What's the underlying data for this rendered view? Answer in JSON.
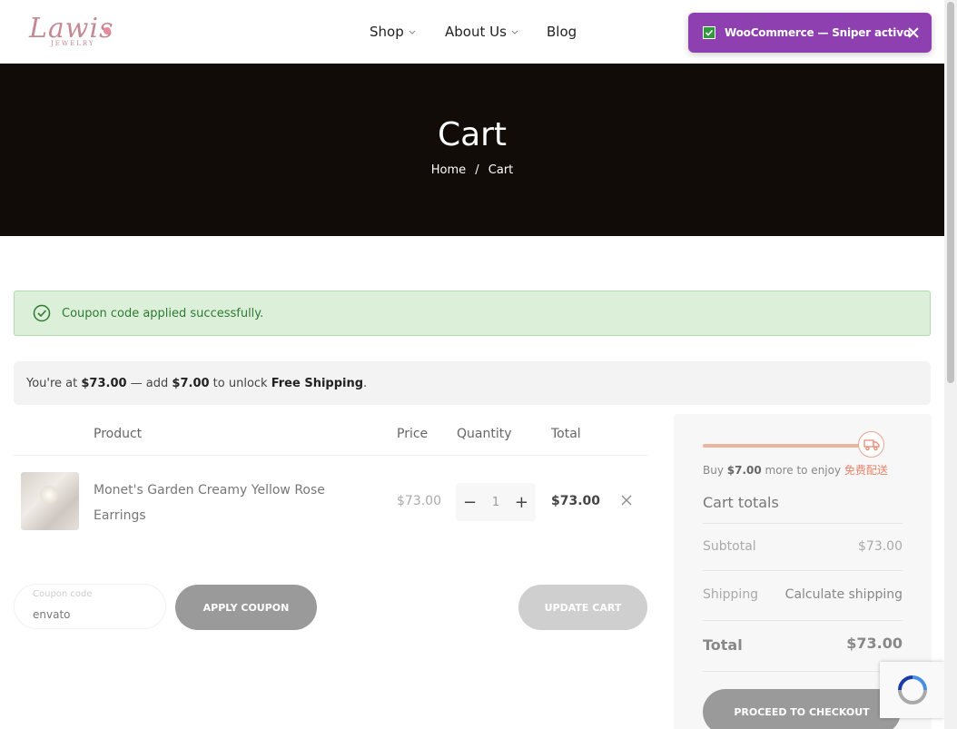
{
  "header": {
    "logo_text": "Lawis",
    "logo_subtext": "JEWELRY",
    "nav": [
      {
        "label": "Shop",
        "has_dropdown": true
      },
      {
        "label": "About Us",
        "has_dropdown": true
      },
      {
        "label": "Blog",
        "has_dropdown": false
      }
    ]
  },
  "toast": {
    "text": "WooCommerce — Sniper activo",
    "color": "#8e3fb0"
  },
  "hero": {
    "title": "Cart",
    "breadcrumb": {
      "home": "Home",
      "separator": "/",
      "current": "Cart"
    }
  },
  "notice": {
    "text": "Coupon code applied successfully."
  },
  "free_shipping": {
    "prefix": "You're at ",
    "current_amount": "$73.00",
    "middle": " — add ",
    "remaining_amount": "$7.00",
    "suffix": " to unlock ",
    "goal": "Free Shipping",
    "end": "."
  },
  "cart": {
    "columns": {
      "product": "Product",
      "price": "Price",
      "quantity": "Quantity",
      "total": "Total"
    },
    "items": [
      {
        "name": "Monet's Garden Creamy Yellow Rose Earrings",
        "price": "$73.00",
        "quantity": "1",
        "total": "$73.00"
      }
    ],
    "coupon": {
      "placeholder": "Coupon code",
      "value": "envato"
    },
    "apply_coupon_label": "Apply coupon",
    "update_cart_label": "Update cart"
  },
  "totals": {
    "progress_fraction": 0.9125,
    "buy_more_prefix": "Buy ",
    "buy_more_amount": "$7.00",
    "buy_more_middle": " more to enjoy ",
    "buy_more_free": "免费配送",
    "title": "Cart totals",
    "subtotal_label": "Subtotal",
    "subtotal_value": "$73.00",
    "shipping_label": "Shipping",
    "shipping_value": "Calculate shipping",
    "total_label": "Total",
    "total_value": "$73.00",
    "checkout_label": "Proceed to checkout"
  }
}
